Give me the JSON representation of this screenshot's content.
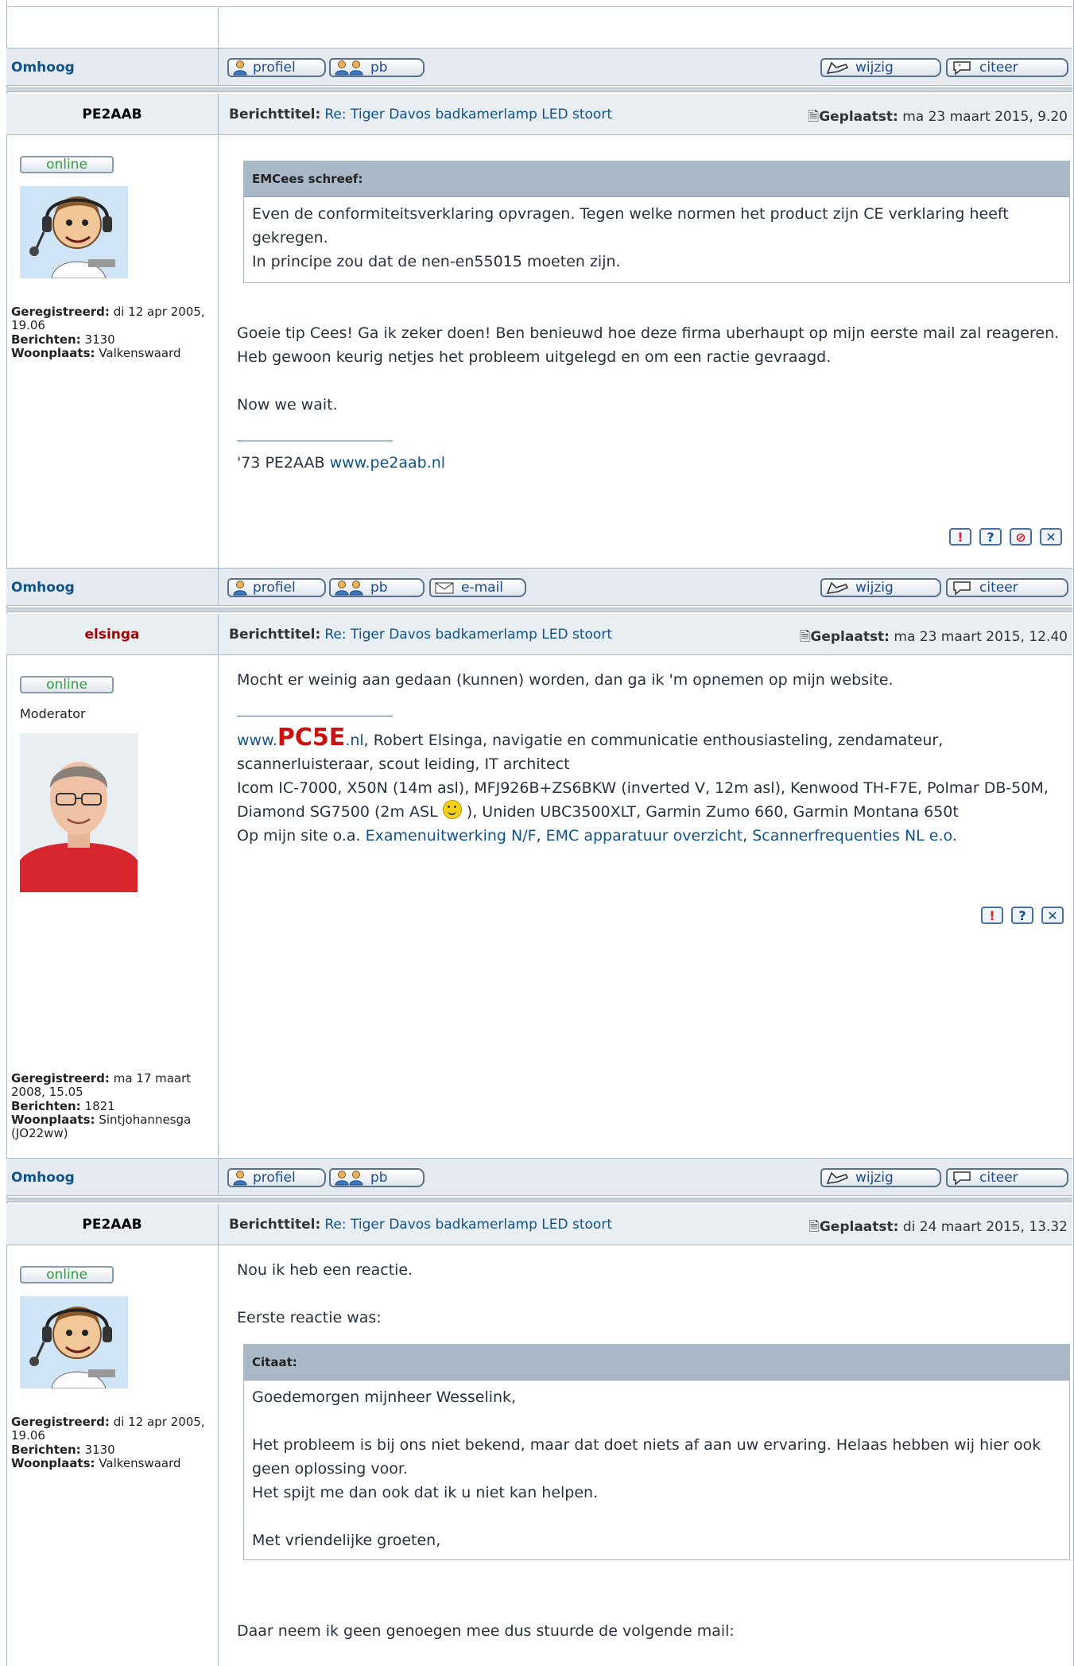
{
  "nav": {
    "top_label": "Omhoog"
  },
  "buttons": {
    "profile": "profiel",
    "pm": "pb",
    "email": "e-mail",
    "edit": "wijzig",
    "quote": "citeer"
  },
  "labels": {
    "subject": "Berichttitel:",
    "posted": "Geplaatst:",
    "registered": "Geregistreerd:",
    "posts": "Berichten:",
    "location": "Woonplaats:",
    "online": "online"
  },
  "posts": [
    {
      "author": "PE2AAB",
      "author_color": "#222222",
      "subject": "Re: Tiger Davos badkamerlamp LED stoort",
      "posted": "ma 23 maart 2015, 9.20",
      "registered": "di 12 apr 2005, 19.06",
      "post_count": "3130",
      "location": "Valkenswaard",
      "quote_author": "EMCees schreef:",
      "quote_line1": "Even de conformiteitsverklaring opvragen. Tegen welke normen het product zijn CE verklaring heeft gekregen.",
      "quote_line2": "In principe zou dat de nen-en55015 moeten zijn.",
      "body_line1": "Goeie tip Cees! Ga ik zeker doen! Ben benieuwd hoe deze firma uberhaupt op mijn eerste mail zal reageren. Heb gewoon keurig netjes het probleem uitgelegd en om een ractie gevraagd.",
      "body_line2": "Now we wait.",
      "sig_prefix": "'73 PE2AAB ",
      "sig_link": "www.pe2aab.nl"
    },
    {
      "author": "elsinga",
      "author_color": "#aa0000",
      "subject": "Re: Tiger Davos badkamerlamp LED stoort",
      "posted": "ma 23 maart 2015, 12.40",
      "rank": "Moderator",
      "registered": "ma 17 maart 2008, 15.05",
      "post_count": "1821",
      "location": "Sintjohannesga (JO22ww)",
      "body_line1": "Mocht er weinig aan gedaan (kunnen) worden, dan ga ik 'm opnemen op mijn website.",
      "sig_www": "www.",
      "sig_brand": "PC5E",
      "sig_tld": ".nl",
      "sig_text1": ", Robert Elsinga, navigatie en communicatie enthousiasteling, zendamateur, scannerluisteraar, scout leiding, IT architect",
      "sig_text2a": "Icom IC-7000, X50N (14m asl), MFJ926B+ZS6BKW (inverted V, 12m asl), Kenwood TH-F7E, Polmar DB-50M, Diamond SG7500 (2m ASL ",
      "sig_text2b": " ), Uniden UBC3500XLT, Garmin Zumo 660, Garmin Montana 650t",
      "sig_text3": "Op mijn site o.a. ",
      "sig_link1": "Examenuitwerking N/F",
      "sig_link2": "EMC apparatuur overzicht",
      "sig_link3": "Scannerfrequenties NL e.o."
    },
    {
      "author": "PE2AAB",
      "author_color": "#222222",
      "subject": "Re: Tiger Davos badkamerlamp LED stoort",
      "posted": "di 24 maart 2015, 13.32",
      "registered": "di 12 apr 2005, 19.06",
      "post_count": "3130",
      "location": "Valkenswaard",
      "body_line1": "Nou ik heb een reactie.",
      "body_line2": "Eerste reactie was:",
      "quote_author": "Citaat:",
      "quote_line1": "Goedemorgen mijnheer Wesselink,",
      "quote_line2": "Het probleem is bij ons niet bekend, maar dat doet niets af aan uw ervaring. Helaas hebben wij hier ook geen oplossing voor.",
      "quote_line3": "Het spijt me dan ook dat ik u niet kan helpen.",
      "quote_line4": "Met vriendelijke groeten,",
      "body_line3": "Daar neem ik geen genoegen mee dus stuurde de volgende mail:"
    }
  ],
  "colors": {
    "link": "#105289",
    "brand_red": "#cc1111",
    "online_green": "#2e9e3e"
  }
}
